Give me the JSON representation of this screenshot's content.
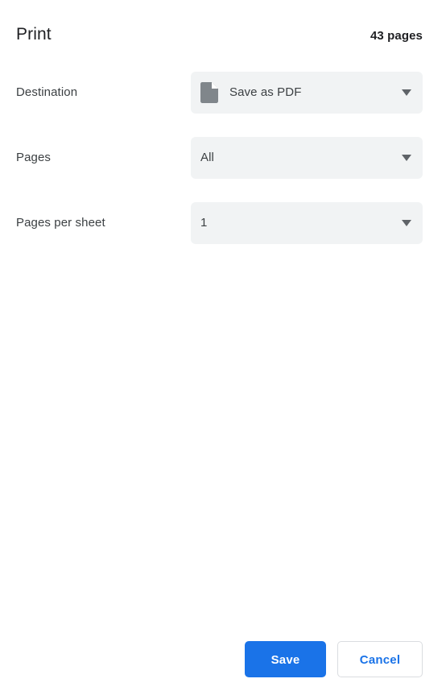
{
  "dialog": {
    "title": "Print",
    "page_count": "43 pages",
    "settings": [
      {
        "label": "Destination",
        "value": "Save as PDF",
        "icon": "document-icon",
        "has_icon": true
      },
      {
        "label": "Pages",
        "value": "All",
        "icon": null,
        "has_icon": false
      },
      {
        "label": "Pages per sheet",
        "value": "1",
        "icon": null,
        "has_icon": false
      }
    ],
    "footer": {
      "save_label": "Save",
      "cancel_label": "Cancel"
    }
  },
  "colors": {
    "accent": "#1a73e8",
    "field_background": "#f1f3f4",
    "text_primary": "#202124",
    "text_secondary": "#3c4043",
    "icon_gray": "#80868b",
    "caret_gray": "#5f6368",
    "border": "#dadce0"
  }
}
